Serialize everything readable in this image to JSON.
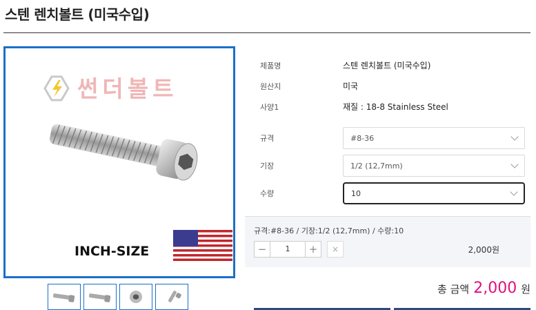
{
  "product": {
    "title": "스텐 렌치볼트 (미국수입)",
    "image_brand": "썬더볼트",
    "image_caption": "INCH-SIZE"
  },
  "info": {
    "name_label": "제품명",
    "name_value": "스텐 렌치볼트 (미국수입)",
    "origin_label": "원산지",
    "origin_value": "미국",
    "spec_label": "사양1",
    "spec_value": "재질 : 18-8 Stainless Steel"
  },
  "options": {
    "size_label": "규격",
    "size_value": "#8-36",
    "length_label": "기장",
    "length_value": "1/2 (12,7mm)",
    "qty_label": "수량",
    "qty_value": "10"
  },
  "selection": {
    "summary": "규격:#8-36 / 기장:1/2 (12,7mm) / 수량:10",
    "quantity": "1",
    "minus": "−",
    "plus": "+",
    "remove": "×",
    "price": "2,000원"
  },
  "total": {
    "label": "총 금액",
    "amount": "2,000",
    "unit": "원"
  },
  "colors": {
    "accent": "#1a6fc9",
    "price": "#e0117c"
  }
}
